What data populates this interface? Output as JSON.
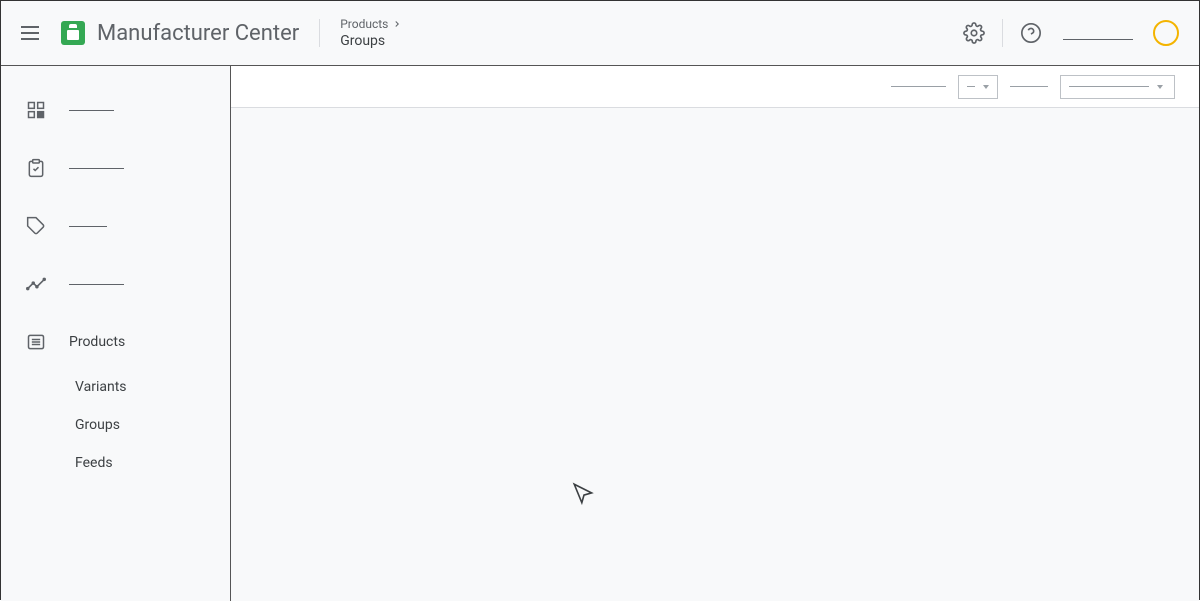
{
  "header": {
    "app_title": "Manufacturer Center",
    "breadcrumb_parent": "Products",
    "breadcrumb_current": "Groups"
  },
  "sidebar": {
    "items": [
      {
        "label": "",
        "icon": "dashboard"
      },
      {
        "label": "",
        "icon": "clipboard"
      },
      {
        "label": "",
        "icon": "tag"
      },
      {
        "label": "",
        "icon": "chart"
      }
    ],
    "products_label": "Products",
    "sub_items": {
      "variants": "Variants",
      "groups": "Groups",
      "feeds": "Feeds"
    }
  },
  "toolbar": {
    "filter1_label": "",
    "filter1_value": "",
    "filter2_label": "",
    "filter2_value": ""
  }
}
